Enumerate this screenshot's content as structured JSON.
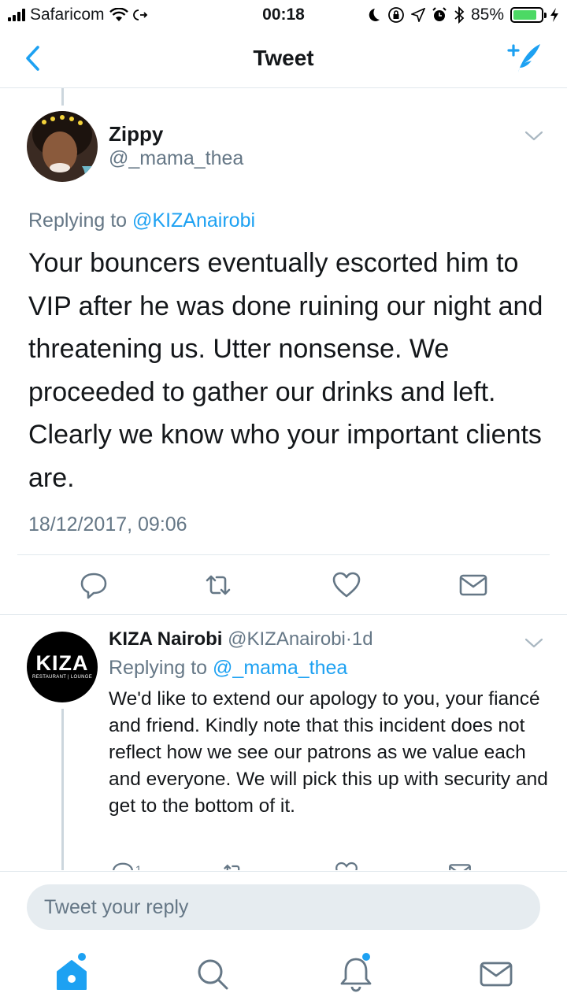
{
  "status_bar": {
    "carrier": "Safaricom",
    "time": "00:18",
    "battery_percent": "85%",
    "battery_level": 0.85,
    "battery_color": "#4cd964"
  },
  "nav": {
    "title": "Tweet",
    "back_icon": "chevron-left-icon",
    "compose_icon": "compose-tweet-icon"
  },
  "main_tweet": {
    "display_name": "Zippy",
    "handle": "@_mama_thea",
    "replying_prefix": "Replying to ",
    "replying_to": "@KIZAnairobi",
    "text": "Your bouncers eventually escorted him to VIP after he was done ruining our night and threatening us. Utter nonsense. We proceeded to gather our drinks and left. Clearly we know who your important clients are.",
    "timestamp": "18/12/2017, 09:06",
    "actions": [
      "reply-icon",
      "retweet-icon",
      "like-icon",
      "direct-message-icon"
    ]
  },
  "reply_tweet": {
    "display_name": "KIZA Nairobi",
    "handle": "@KIZAnairobi",
    "separator": "·",
    "age": "1d",
    "avatar_logo": "KIZA",
    "avatar_subtitle": "RESTAURANT | LOUNGE",
    "replying_prefix": "Replying to ",
    "replying_to": "@_mama_thea",
    "text": "We'd like to extend our apology to you, your fiancé and friend. Kindly note that this incident does not reflect how we see our patrons as we value each and everyone. We will pick this up with security and get to the bottom of it.",
    "reply_count": "1"
  },
  "composer": {
    "placeholder": "Tweet your reply"
  },
  "tab_bar": {
    "tabs": [
      "home-icon",
      "search-icon",
      "notifications-icon",
      "messages-icon"
    ]
  },
  "colors": {
    "accent": "#1da1f2",
    "secondary_text": "#657786",
    "divider": "#e1e8ed",
    "icon_gray": "#657786"
  }
}
